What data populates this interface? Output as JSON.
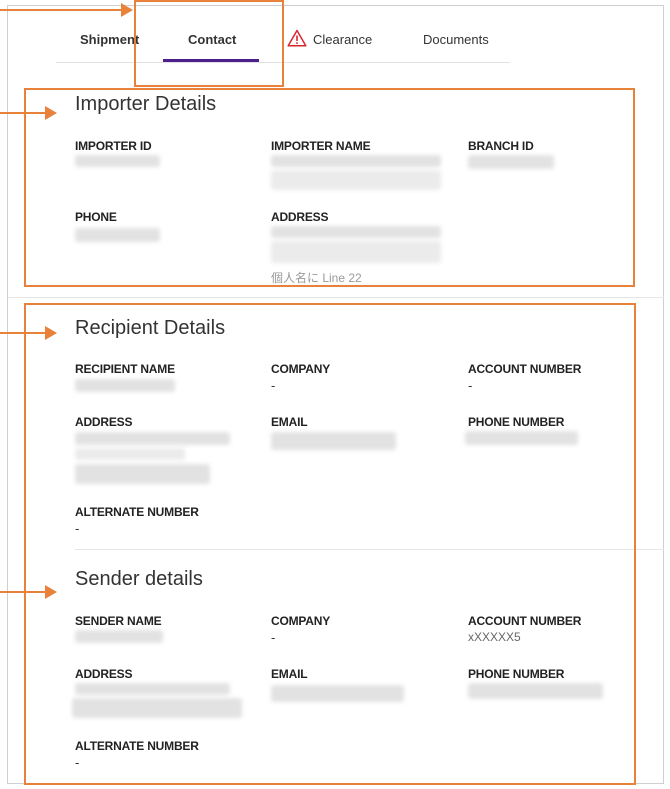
{
  "tabs": [
    {
      "label": "Shipment"
    },
    {
      "label": "Contact"
    },
    {
      "label": "Clearance"
    },
    {
      "label": "Documents"
    }
  ],
  "importer": {
    "title": "Importer Details",
    "id_label": "IMPORTER ID",
    "name_label": "IMPORTER NAME",
    "branch_label": "BRANCH ID",
    "phone_label": "PHONE",
    "address_label": "ADDRESS",
    "address_tail": "個人名に Line 22"
  },
  "recipient": {
    "title": "Recipient Details",
    "name_label": "RECIPIENT NAME",
    "company_label": "COMPANY",
    "company_value": "-",
    "account_label": "ACCOUNT NUMBER",
    "account_value": "-",
    "address_label": "ADDRESS",
    "email_label": "EMAIL",
    "phone_label": "PHONE NUMBER",
    "alt_label": "ALTERNATE NUMBER",
    "alt_value": "-"
  },
  "sender": {
    "title": "Sender details",
    "name_label": "SENDER NAME",
    "company_label": "COMPANY",
    "company_value": "-",
    "account_label": "ACCOUNT NUMBER",
    "account_value": "xXXXXX5",
    "address_label": "ADDRESS",
    "email_label": "EMAIL",
    "phone_label": "PHONE NUMBER",
    "alt_label": "ALTERNATE NUMBER",
    "alt_value": "-"
  },
  "colors": {
    "annotation": "#e8823a",
    "active_tab": "#4d1f8c",
    "warning": "#d9262c"
  },
  "icons": [
    "warning-triangle-icon"
  ]
}
